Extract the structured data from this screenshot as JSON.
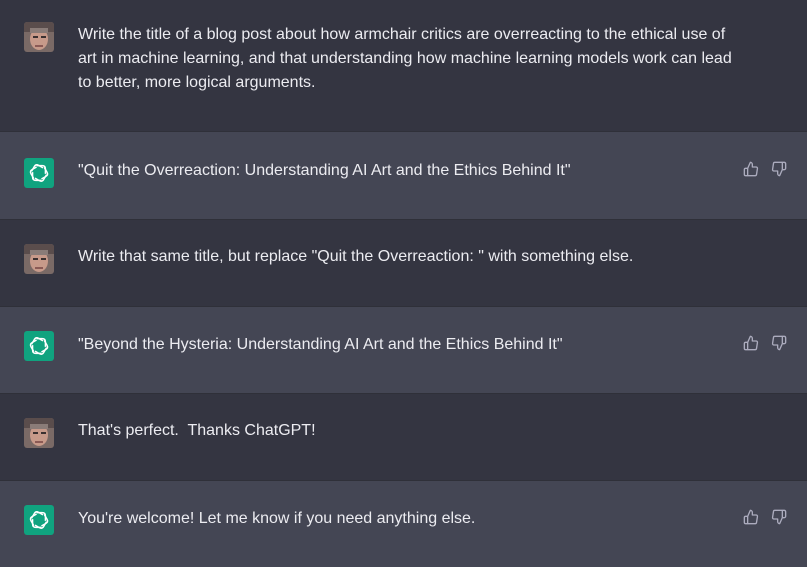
{
  "messages": [
    {
      "role": "user",
      "text": "Write the title of a blog post about how armchair critics are overreacting to the ethical use of art in machine learning, and that understanding how machine learning models work can lead to better, more logical arguments."
    },
    {
      "role": "assistant",
      "text": "\"Quit the Overreaction: Understanding AI Art and the Ethics Behind It\""
    },
    {
      "role": "user",
      "text": "Write that same title, but replace \"Quit the Overreaction: \" with something else."
    },
    {
      "role": "assistant",
      "text": "\"Beyond the Hysteria: Understanding AI Art and the Ethics Behind It\""
    },
    {
      "role": "user",
      "text": "That's perfect.  Thanks ChatGPT!"
    },
    {
      "role": "assistant",
      "text": "You're welcome! Let me know if you need anything else."
    }
  ],
  "icons": {
    "assistant_avatar": "openai-logo-icon",
    "user_avatar": "user-photo-avatar",
    "feedback_up": "thumbs-up-icon",
    "feedback_down": "thumbs-down-icon"
  },
  "colors": {
    "user_bg": "#343541",
    "assistant_bg": "#444654",
    "assistant_avatar_bg": "#10a37f",
    "text": "#ececf1",
    "icon": "#acacbe"
  }
}
